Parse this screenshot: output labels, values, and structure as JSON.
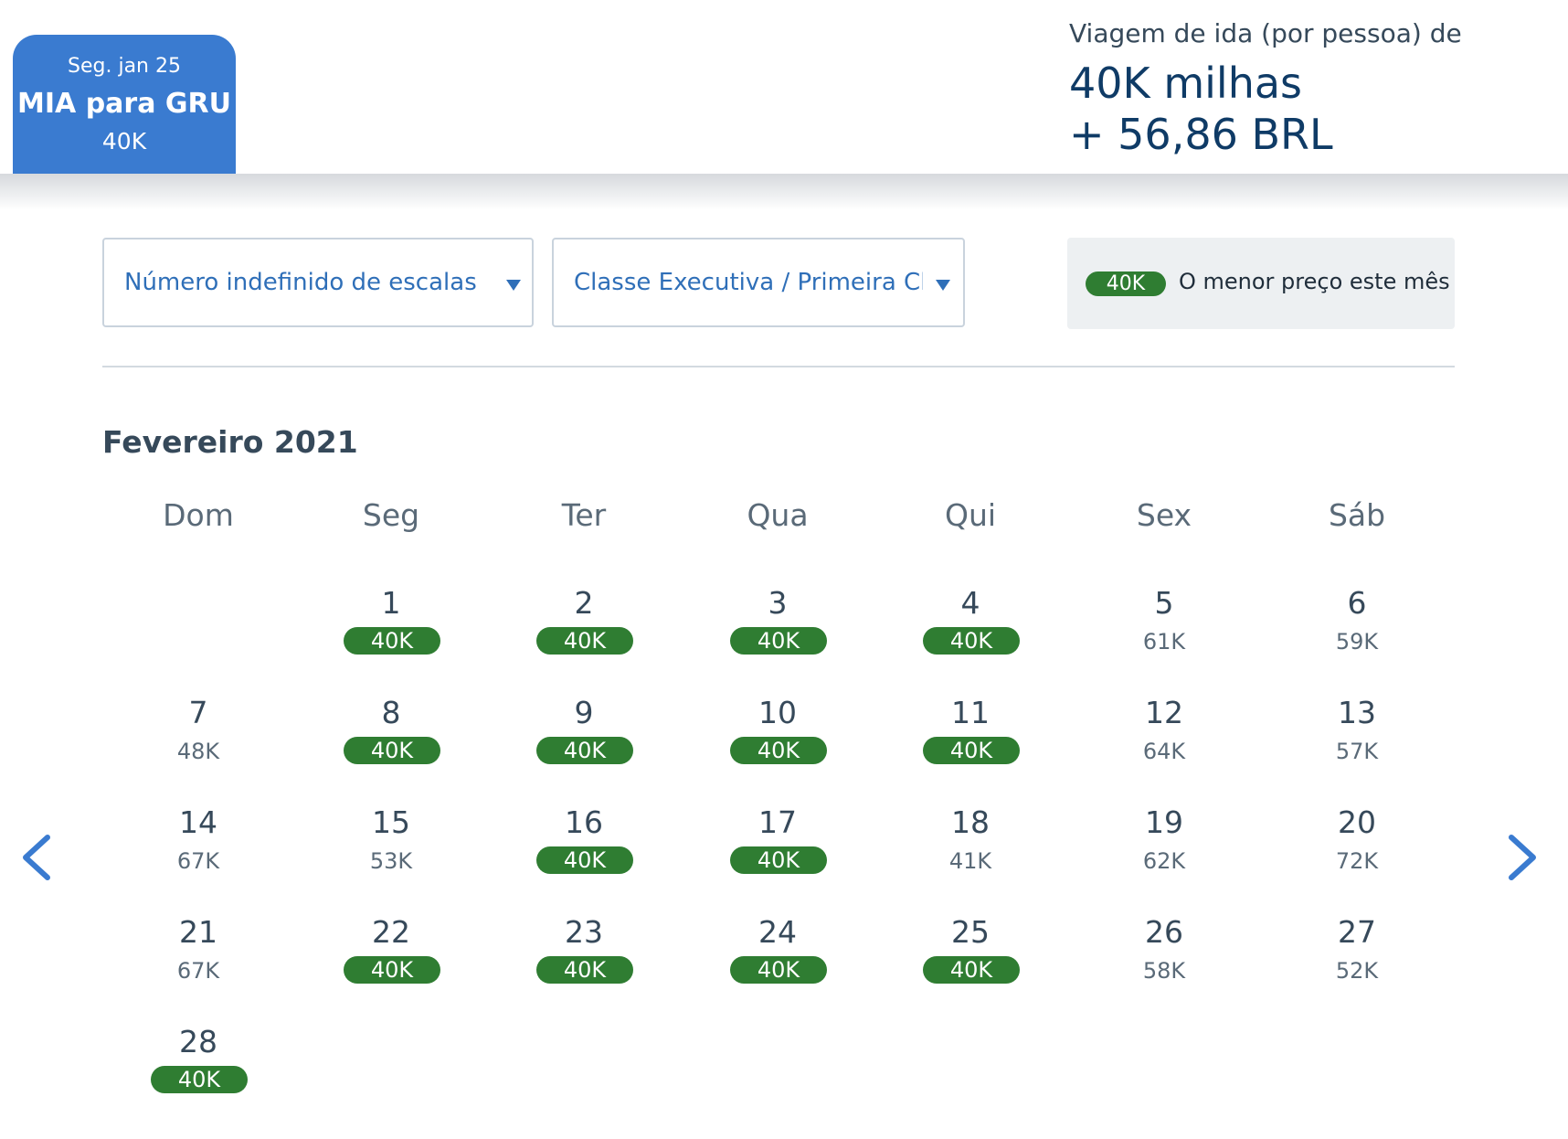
{
  "flight_tab": {
    "date": "Seg. jan 25",
    "route": "MIA para GRU",
    "price": "40K"
  },
  "fare": {
    "label": "Viagem de ida (por pessoa) de",
    "miles": "40K milhas",
    "cash": "+ 56,86 BRL"
  },
  "filters": {
    "stops": "Número indefinido de escalas",
    "cabin": "Classe Executiva / Primeira Classe"
  },
  "lowest": {
    "badge": "40K",
    "text": "O menor preço este mês"
  },
  "calendar": {
    "month": "Fevereiro 2021",
    "weekdays": [
      "Dom",
      "Seg",
      "Ter",
      "Qua",
      "Qui",
      "Sex",
      "Sáb"
    ],
    "first_weekday": 1,
    "lowest_price": "40K",
    "days": [
      {
        "day": "1",
        "price": "40K"
      },
      {
        "day": "2",
        "price": "40K"
      },
      {
        "day": "3",
        "price": "40K"
      },
      {
        "day": "4",
        "price": "40K"
      },
      {
        "day": "5",
        "price": "61K"
      },
      {
        "day": "6",
        "price": "59K"
      },
      {
        "day": "7",
        "price": "48K"
      },
      {
        "day": "8",
        "price": "40K"
      },
      {
        "day": "9",
        "price": "40K"
      },
      {
        "day": "10",
        "price": "40K"
      },
      {
        "day": "11",
        "price": "40K"
      },
      {
        "day": "12",
        "price": "64K"
      },
      {
        "day": "13",
        "price": "57K"
      },
      {
        "day": "14",
        "price": "67K"
      },
      {
        "day": "15",
        "price": "53K"
      },
      {
        "day": "16",
        "price": "40K"
      },
      {
        "day": "17",
        "price": "40K"
      },
      {
        "day": "18",
        "price": "41K"
      },
      {
        "day": "19",
        "price": "62K"
      },
      {
        "day": "20",
        "price": "72K"
      },
      {
        "day": "21",
        "price": "67K"
      },
      {
        "day": "22",
        "price": "40K"
      },
      {
        "day": "23",
        "price": "40K"
      },
      {
        "day": "24",
        "price": "40K"
      },
      {
        "day": "25",
        "price": "40K"
      },
      {
        "day": "26",
        "price": "58K"
      },
      {
        "day": "27",
        "price": "52K"
      },
      {
        "day": "28",
        "price": "40K"
      }
    ]
  },
  "icons": {
    "prev": "chevron-left-icon",
    "next": "chevron-right-icon"
  },
  "colors": {
    "accent": "#3a7bd0",
    "link": "#2f6fb8",
    "lowest": "#2f7d32",
    "heading": "#0f3b66"
  }
}
